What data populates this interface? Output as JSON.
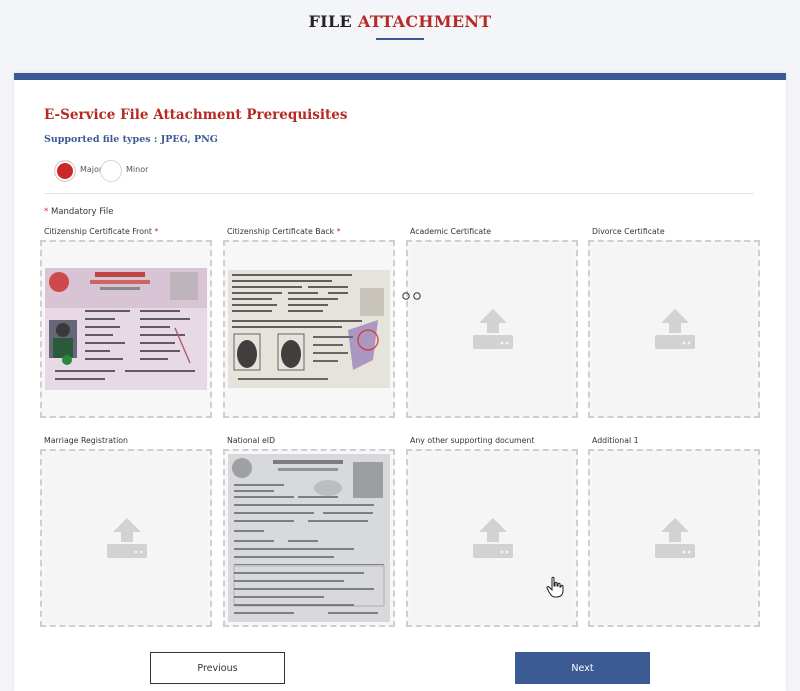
{
  "header": {
    "title_plain": "FILE",
    "title_accent": "ATTACHMENT"
  },
  "section": {
    "title": "E-Service File Attachment Prerequisites",
    "file_types": "Supported file types : JPEG, PNG"
  },
  "applicant_type": {
    "options": [
      {
        "label": "Major",
        "selected": true
      },
      {
        "label": "Minor",
        "selected": false
      }
    ]
  },
  "mandatory": {
    "star": "*",
    "label": "Mandatory File"
  },
  "uploads": [
    {
      "label": "Citizenship Certificate Front",
      "required": true,
      "required_mark": "*",
      "has_file": true,
      "preview": "citizenship-front"
    },
    {
      "label": "Citizenship Certificate Back",
      "required": true,
      "required_mark": "*",
      "has_file": true,
      "preview": "citizenship-back"
    },
    {
      "label": "Academic Certificate",
      "required": false,
      "required_mark": "",
      "has_file": false,
      "preview": ""
    },
    {
      "label": "Divorce Certificate",
      "required": false,
      "required_mark": "",
      "has_file": false,
      "preview": ""
    },
    {
      "label": "Marriage Registration",
      "required": false,
      "required_mark": "",
      "has_file": false,
      "preview": ""
    },
    {
      "label": "National eID",
      "required": false,
      "required_mark": "",
      "has_file": true,
      "preview": "national-eid"
    },
    {
      "label": "Any other supporting document",
      "required": false,
      "required_mark": "",
      "has_file": false,
      "preview": ""
    },
    {
      "label": "Additional 1",
      "required": false,
      "required_mark": "",
      "has_file": false,
      "preview": ""
    }
  ],
  "buttons": {
    "previous": "Previous",
    "next": "Next"
  },
  "colors": {
    "brand_blue": "#3b5a94",
    "accent_red": "#b52a25",
    "radio_red": "#cd2828",
    "dashed_border": "#cfcfcf"
  },
  "icons": {
    "upload": "upload-tray-icon",
    "cursor": "hand-pointer-icon"
  }
}
